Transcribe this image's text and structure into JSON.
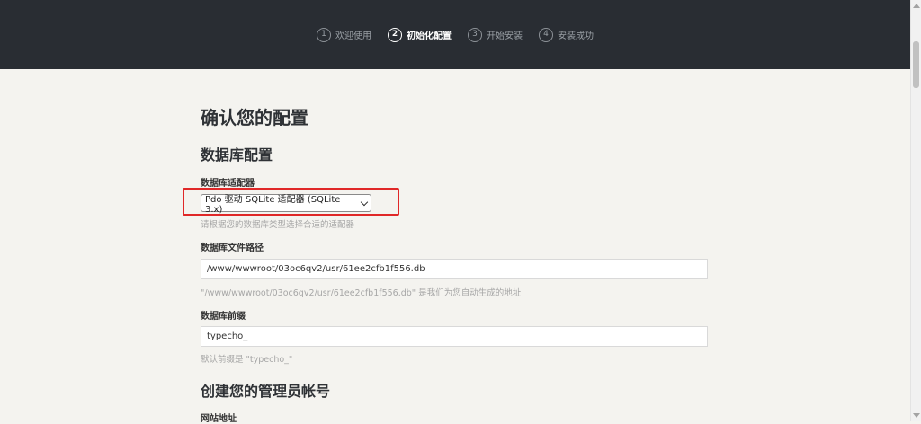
{
  "steps": [
    {
      "num": "1",
      "label": "欢迎使用"
    },
    {
      "num": "2",
      "label": "初始化配置"
    },
    {
      "num": "3",
      "label": "开始安装"
    },
    {
      "num": "4",
      "label": "安装成功"
    }
  ],
  "current_step": 2,
  "page_title": "确认您的配置",
  "db_section_title": "数据库配置",
  "adapter": {
    "label": "数据库适配器",
    "selected": "Pdo 驱动 SQLite 适配器 (SQLite 3.x)",
    "desc": "请根据您的数据库类型选择合适的适配器"
  },
  "file_path": {
    "label": "数据库文件路径",
    "value": "/www/wwwroot/03oc6qv2/usr/61ee2cfb1f556.db",
    "desc": "\"/www/wwwroot/03oc6qv2/usr/61ee2cfb1f556.db\" 是我们为您自动生成的地址"
  },
  "prefix": {
    "label": "数据库前缀",
    "value": "typecho_",
    "desc": "默认前缀是 \"typecho_\""
  },
  "admin_section_title": "创建您的管理员帐号",
  "site_url_label": "网站地址",
  "colors": {
    "header_bg": "#292d33",
    "page_bg": "#f4f3ef",
    "highlight": "#e02828"
  }
}
